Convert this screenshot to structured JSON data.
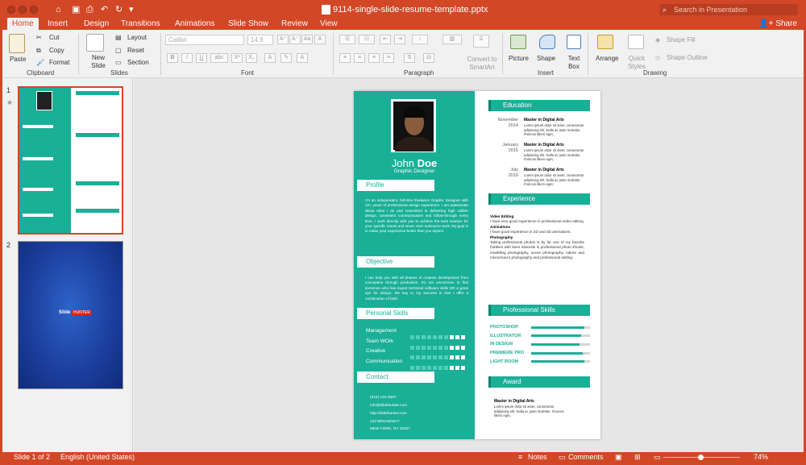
{
  "window": {
    "title": "9114-single-slide-resume-template.pptx"
  },
  "search": {
    "placeholder": "Search in Presentation"
  },
  "tabs": [
    "Home",
    "Insert",
    "Design",
    "Transitions",
    "Animations",
    "Slide Show",
    "Review",
    "View"
  ],
  "share_label": "Share",
  "ribbon": {
    "clipboard": {
      "paste": "Paste",
      "cut": "Cut",
      "copy": "Copy",
      "format": "Format",
      "group": "Clipboard"
    },
    "slides": {
      "new_slide": "New Slide",
      "layout": "Layout",
      "reset": "Reset",
      "section": "Section",
      "group": "Slides"
    },
    "font": {
      "font_name": "Calibri",
      "font_size": "14.9",
      "group": "Font"
    },
    "paragraph": {
      "convert": "Convert to SmartArt",
      "group": "Paragraph"
    },
    "insert": {
      "picture": "Picture",
      "shape": "Shape",
      "text_box": "Text Box",
      "group": "Insert"
    },
    "drawing": {
      "arrange": "Arrange",
      "quick_styles": "Quick Styles",
      "shape_fill": "Shape Fill",
      "shape_outline": "Shape Outline",
      "group": "Drawing"
    }
  },
  "thumbnails": [
    {
      "number": "1"
    },
    {
      "number": "2",
      "brand": "Slide",
      "brand_badge": "HUNTER"
    }
  ],
  "resume": {
    "name_first": "John",
    "name_last": "Doe",
    "job_title": "Graphic Designer",
    "profile": {
      "heading": "Profile",
      "text": "I'm an independent, full-time freelance Graphic Designer with 10+ years of professional design experience. I am passionate about what I do and committed to delivering high caliber design, consistent communication and follow-through every time. I work directly with you to achieve the best solution for your specific needs and never, ever outsource work. My goal is to make your experience better than you expect."
    },
    "objective": {
      "heading": "Objective",
      "text": "I can help you with all phases of creative development from conception through production. It's not uncommon to find someone who has expert technical software skills OR a great eye for design; the key to my success is that I offer a combination of both."
    },
    "personal_skills": {
      "heading": "Personal Skills",
      "items": [
        {
          "name": "Management",
          "filled": 6
        },
        {
          "name": "Team WOrk",
          "filled": 6
        },
        {
          "name": "Creative",
          "filled": 6
        },
        {
          "name": "Communication",
          "filled": 6
        }
      ]
    },
    "contact": {
      "heading": "Contact",
      "phone": "(212) 123 4567",
      "email": "info@slidehunter.com",
      "web": "http://slidehunter.com",
      "street": "123 BROADWAY",
      "city": "NEW YORK, NY 10027"
    },
    "education": {
      "heading": "Education",
      "items": [
        {
          "month": "November",
          "year": "2014",
          "title": "Master in Digital Arts",
          "desc": "Lorem ipsum dolor sit amet, consectetur adipiscing elit. Nulla ac justo molestie, rhoncus libero eget,"
        },
        {
          "month": "January",
          "year": "2015",
          "title": "Master in Digital Arts",
          "desc": "Lorem ipsum dolor sit amet, consectetur adipiscing elit. Nulla ac justo molestie, rhoncus libero eget,"
        },
        {
          "month": "July",
          "year": "2016",
          "title": "Master in Digital Arts",
          "desc": "Lorem ipsum dolor sit amet, consectetur adipiscing elit. Nulla ac justo molestie, rhoncus libero eget,"
        }
      ]
    },
    "experience": {
      "heading": "Experience",
      "items": [
        {
          "title": "Video Editing",
          "text": "I have very good experience in professional video editing."
        },
        {
          "title": "Animations",
          "text": "I have good experience in 2D and 3D animations."
        },
        {
          "title": "Photography",
          "text": "Taking professional photos is by far one of my favorite hobbies with keen interests in professional photo shoots, modelling photography, scene photography, nature and micro/macro photography and professional editing."
        }
      ]
    },
    "professional_skills": {
      "heading": "Professional Skills",
      "items": [
        {
          "name": "PHOTOSHOP",
          "level": 0.9
        },
        {
          "name": "ILLUSTRATOR",
          "level": 0.85
        },
        {
          "name": "IN DESIGN",
          "level": 0.82
        },
        {
          "name": "PREMIERE PRO",
          "level": 0.88
        },
        {
          "name": "LIGHT ROOM",
          "level": 0.9
        }
      ]
    },
    "award": {
      "heading": "Award",
      "title": "Master in Digital Arts",
      "desc": "Lorem ipsum dolor sit amet, consectetur adipiscing elit. Nulla ac justo molestie, rhoncus libero eget,"
    }
  },
  "status": {
    "slide": "Slide 1 of 2",
    "language": "English (United States)",
    "notes": "Notes",
    "comments": "Comments",
    "zoom": "74%"
  },
  "colors": {
    "accent": "#d24726",
    "teal": "#1aaf97"
  }
}
